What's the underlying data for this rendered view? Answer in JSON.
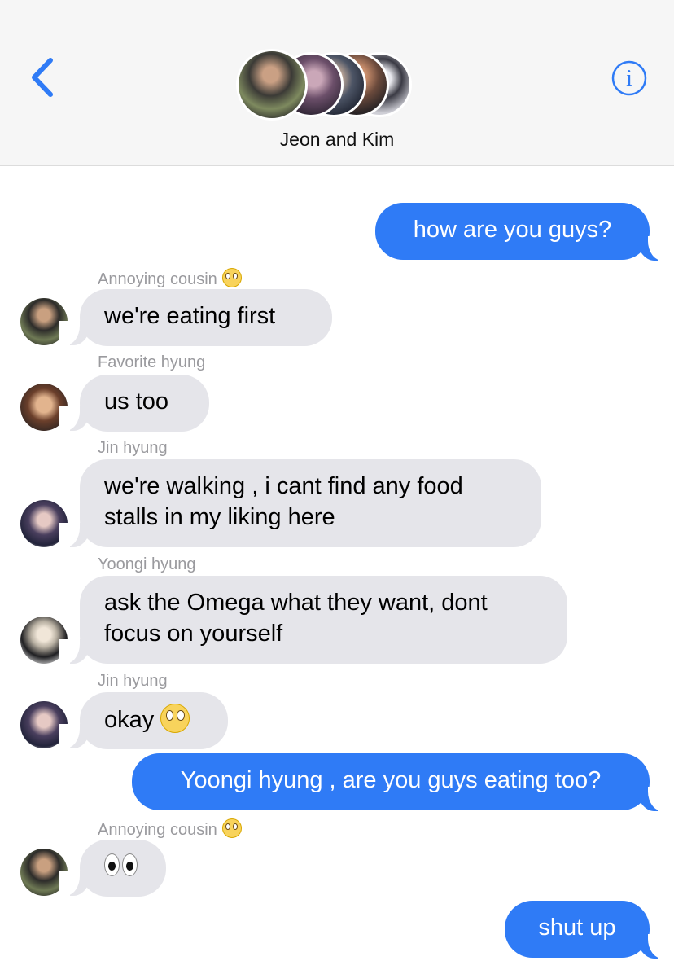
{
  "header": {
    "group_title": "Jeon and Kim",
    "back_icon": "chevron-left-icon",
    "info_icon": "info-circle-icon",
    "info_glyph": "i",
    "accent": "#2f7bf6",
    "group_avatars": [
      "avatar-1",
      "avatar-2",
      "avatar-3",
      "avatar-4",
      "avatar-5"
    ]
  },
  "messages": [
    {
      "direction": "outgoing",
      "text": "how are you guys?"
    },
    {
      "direction": "incoming",
      "sender": "Annoying cousin",
      "sender_emoji": "eye-roll-emoji",
      "text": "we're eating first"
    },
    {
      "direction": "incoming",
      "sender": "Favorite hyung",
      "text": "us too"
    },
    {
      "direction": "incoming",
      "sender": "Jin hyung",
      "text_line1": "we're walking , i cant find any food",
      "text_line2": "stalls in my liking here"
    },
    {
      "direction": "incoming",
      "sender": "Yoongi hyung",
      "text_line1": "ask the Omega what they want, dont",
      "text_line2": "focus on yourself"
    },
    {
      "direction": "incoming",
      "sender": "Jin hyung",
      "text": "okay",
      "emoji": "eye-roll-emoji"
    },
    {
      "direction": "outgoing",
      "text": "Yoongi hyung , are you guys eating too?"
    },
    {
      "direction": "incoming",
      "sender": "Annoying cousin",
      "sender_emoji": "eye-roll-emoji",
      "emoji": "eyes-emoji"
    },
    {
      "direction": "outgoing",
      "text": "shut up"
    }
  ],
  "colors": {
    "incoming_bubble": "#e5e5ea",
    "outgoing_bubble": "#2f7bf6",
    "sender_label": "#9a9a9e"
  }
}
